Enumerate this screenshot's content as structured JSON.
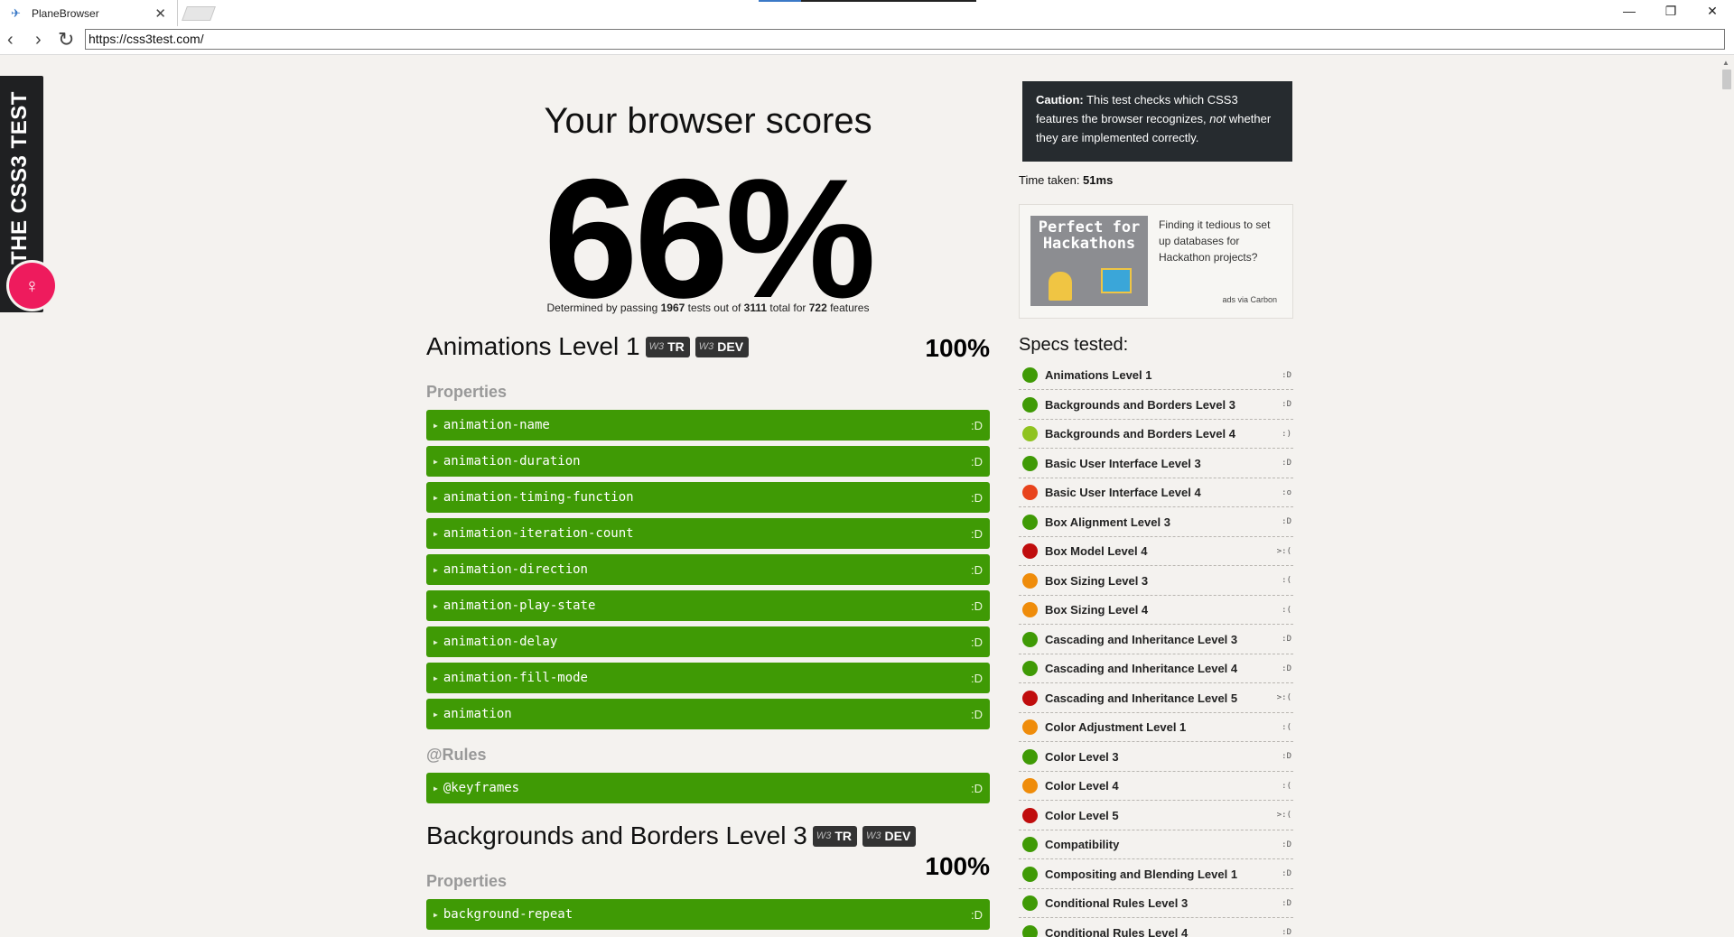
{
  "browser": {
    "tab_title": "PlaneBrowser",
    "tab_close": "✕",
    "url": "https://css3test.com/",
    "minimize": "—",
    "restore": "❐",
    "close": "✕"
  },
  "ribbon": {
    "title": "THE CSS3 TEST"
  },
  "score": {
    "heading": "Your browser scores",
    "percent": "66%",
    "sub_prefix": "Determined by passing ",
    "passed": "1967",
    "sub_mid1": " tests out of ",
    "total": "3111",
    "sub_mid2": " total for ",
    "features": "722",
    "sub_suffix": " features"
  },
  "specs": [
    {
      "title": "Animations Level 1",
      "badges": [
        "TR",
        "DEV"
      ],
      "percent": "100%",
      "properties_label": "Properties",
      "properties": [
        "animation-name",
        "animation-duration",
        "animation-timing-function",
        "animation-iteration-count",
        "animation-direction",
        "animation-play-state",
        "animation-delay",
        "animation-fill-mode",
        "animation"
      ],
      "rules_label": "@Rules",
      "rules": [
        "@keyframes"
      ]
    },
    {
      "title": "Backgrounds and Borders Level 3",
      "badges": [
        "TR",
        "DEV"
      ],
      "percent": "100%",
      "properties_label": "Properties",
      "properties": [
        "background-repeat"
      ]
    }
  ],
  "feature_smiley": ":D",
  "w3_mark": "W3",
  "caution": {
    "label": "Caution:",
    "text1": " This test checks which CSS3 features the browser recognizes, ",
    "em": "not",
    "text2": " whether they are implemented correctly."
  },
  "time": {
    "label": "Time taken: ",
    "value": "51ms"
  },
  "ad": {
    "image_text": "Perfect for Hackathons",
    "text": "Finding it tedious to set up databases for Hackathon projects?",
    "via": "ads via Carbon"
  },
  "specs_tested": {
    "heading": "Specs tested:",
    "items": [
      {
        "name": "Animations Level 1",
        "face": ":D",
        "color": "#3f9a05"
      },
      {
        "name": "Backgrounds and Borders Level 3",
        "face": ":D",
        "color": "#3f9a05"
      },
      {
        "name": "Backgrounds and Borders Level 4",
        "face": ":)",
        "color": "#8fc31f"
      },
      {
        "name": "Basic User Interface Level 3",
        "face": ":D",
        "color": "#3f9a05"
      },
      {
        "name": "Basic User Interface Level 4",
        "face": ":o",
        "color": "#e8431c"
      },
      {
        "name": "Box Alignment Level 3",
        "face": ":D",
        "color": "#3f9a05"
      },
      {
        "name": "Box Model Level 4",
        "face": ">:(",
        "color": "#c00d0d"
      },
      {
        "name": "Box Sizing Level 3",
        "face": ":(",
        "color": "#ef8c0a"
      },
      {
        "name": "Box Sizing Level 4",
        "face": ":(",
        "color": "#ef8c0a"
      },
      {
        "name": "Cascading and Inheritance Level 3",
        "face": ":D",
        "color": "#3f9a05"
      },
      {
        "name": "Cascading and Inheritance Level 4",
        "face": ":D",
        "color": "#3f9a05"
      },
      {
        "name": "Cascading and Inheritance Level 5",
        "face": ">:(",
        "color": "#c00d0d"
      },
      {
        "name": "Color Adjustment Level 1",
        "face": ":(",
        "color": "#ef8c0a"
      },
      {
        "name": "Color Level 3",
        "face": ":D",
        "color": "#3f9a05"
      },
      {
        "name": "Color Level 4",
        "face": ":(",
        "color": "#ef8c0a"
      },
      {
        "name": "Color Level 5",
        "face": ">:(",
        "color": "#c00d0d"
      },
      {
        "name": "Compatibility",
        "face": ":D",
        "color": "#3f9a05"
      },
      {
        "name": "Compositing and Blending Level 1",
        "face": ":D",
        "color": "#3f9a05"
      },
      {
        "name": "Conditional Rules Level 3",
        "face": ":D",
        "color": "#3f9a05"
      },
      {
        "name": "Conditional Rules Level 4",
        "face": ":D",
        "color": "#3f9a05"
      }
    ]
  }
}
